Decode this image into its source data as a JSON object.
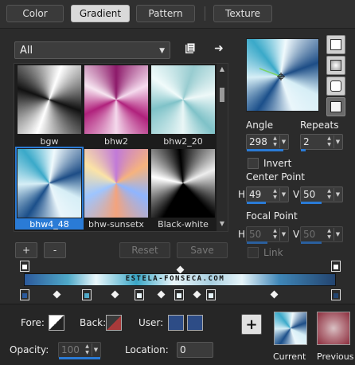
{
  "tabs": [
    {
      "label": "Color"
    },
    {
      "label": "Gradient",
      "active": true
    },
    {
      "label": "Pattern"
    },
    {
      "label": "Texture"
    }
  ],
  "category": {
    "value": "All"
  },
  "gallery": {
    "items": [
      {
        "name": "bgw"
      },
      {
        "name": "bhw2"
      },
      {
        "name": "bhw2_20"
      },
      {
        "name": "bhw4_48",
        "selected": true
      },
      {
        "name": "bhw-sunsetx"
      },
      {
        "name": "Black-white"
      }
    ]
  },
  "buttons": {
    "add": "+",
    "remove": "-",
    "reset": "Reset",
    "save": "Save"
  },
  "settings": {
    "angle_label": "Angle",
    "angle": "298",
    "repeats_label": "Repeats",
    "repeats": "2",
    "invert_label": "Invert",
    "center_point_label": "Center Point",
    "center_h_label": "H",
    "center_h": "49",
    "center_v_label": "V",
    "center_v": "50",
    "focal_point_label": "Focal Point",
    "focal_h_label": "H",
    "focal_h": "50",
    "focal_v_label": "V",
    "focal_v": "50",
    "link_label": "Link"
  },
  "gradient_bar": {
    "watermark": "ESTELA-FONSECA.COM"
  },
  "footer": {
    "fore_label": "Fore:",
    "back_label": "Back:",
    "user_label": "User:",
    "opacity_label": "Opacity:",
    "opacity": "100",
    "location_label": "Location:",
    "location": "0",
    "add_label": "+",
    "current_label": "Current",
    "previous_label": "Previous"
  },
  "colors": {
    "accent": "#2a7bd6",
    "user_swatch": "#2d4c86",
    "back_swatch": "#a83a3a",
    "previous_swatch": "#9a3a48"
  }
}
